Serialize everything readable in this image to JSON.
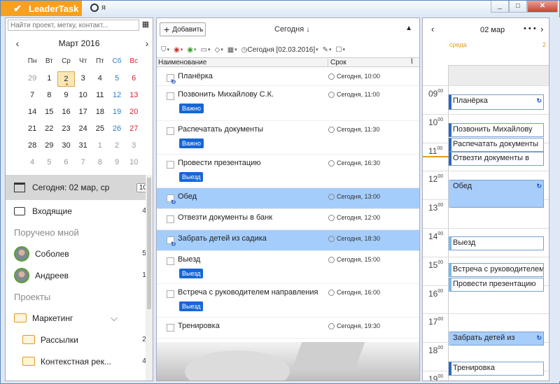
{
  "app": {
    "title": "LeaderTask",
    "user_label": "я"
  },
  "window_buttons": {
    "minimize": "_",
    "maximize": "□",
    "close": "✕"
  },
  "left": {
    "search_placeholder": "Найти проект, метку, контакт...",
    "calendar": {
      "title": "Март 2016",
      "prev": "‹",
      "next": "›",
      "dow": [
        "Пн",
        "Вт",
        "Ср",
        "Чт",
        "Пт",
        "Сб",
        "Вс"
      ],
      "weeks": [
        [
          "29",
          "1",
          "2",
          "3",
          "4",
          "5",
          "6"
        ],
        [
          "7",
          "8",
          "9",
          "10",
          "11",
          "12",
          "13"
        ],
        [
          "14",
          "15",
          "16",
          "17",
          "18",
          "19",
          "20"
        ],
        [
          "21",
          "22",
          "23",
          "24",
          "25",
          "26",
          "27"
        ],
        [
          "28",
          "29",
          "30",
          "31",
          "1",
          "2",
          "3"
        ],
        [
          "4",
          "5",
          "6",
          "7",
          "8",
          "9",
          "10"
        ]
      ],
      "selected": "2"
    },
    "today": {
      "label": "Сегодня: 02 мар, ср",
      "count": "10"
    },
    "inbox": {
      "label": "Входящие",
      "count": "4"
    },
    "assigned_section": "Поручено мной",
    "people": [
      {
        "name": "Соболев",
        "count": "5"
      },
      {
        "name": "Андреев",
        "count": "1"
      }
    ],
    "projects_section": "Проекты",
    "projects": [
      {
        "name": "Маркетинг",
        "count": ""
      },
      {
        "name": "Рассылки",
        "count": "2"
      },
      {
        "name": "Контекстная рек...",
        "count": "4"
      }
    ]
  },
  "middle": {
    "add_button": "Добавить",
    "title": "Сегодня ↓",
    "toolbar_date": "Сегодня [02.03.2016]",
    "col_name": "Наименование",
    "col_due": "Срок",
    "tasks": [
      {
        "name": "Планёрка",
        "time": "Сегодня, 10:00",
        "tag": "",
        "recur": true,
        "selected": false
      },
      {
        "name": "Позвонить Михайлову С.К.",
        "time": "Сегодня, 11:00",
        "tag": "Важно",
        "recur": false,
        "selected": false
      },
      {
        "name": "Распечатать документы",
        "time": "Сегодня, 11:30",
        "tag": "Важно",
        "recur": false,
        "selected": false
      },
      {
        "name": "Провести презентацию",
        "time": "Сегодня, 16:30",
        "tag": "Выезд",
        "recur": false,
        "selected": false
      },
      {
        "name": "Обед",
        "time": "Сегодня, 13:00",
        "tag": "",
        "recur": true,
        "selected": true
      },
      {
        "name": "Отвезти документы в банк",
        "time": "Сегодня, 12:00",
        "tag": "",
        "recur": false,
        "selected": false
      },
      {
        "name": "Забрать детей из садика",
        "time": "Сегодня, 18:30",
        "tag": "",
        "recur": true,
        "selected": true
      },
      {
        "name": "Выезд",
        "time": "Сегодня, 15:00",
        "tag": "Выезд",
        "recur": false,
        "selected": false
      },
      {
        "name": "Встреча с руководителем направления",
        "time": "Сегодня, 16:00",
        "tag": "Выезд",
        "recur": false,
        "selected": false
      },
      {
        "name": "Тренировка",
        "time": "Сегодня, 19:30",
        "tag": "",
        "recur": false,
        "selected": false
      }
    ]
  },
  "right": {
    "date": "02 мар",
    "dots": "• • •",
    "day_name": "среда",
    "day_num": "2",
    "hours": [
      "09",
      "10",
      "11",
      "12",
      "13",
      "14",
      "15",
      "16",
      "17",
      "18",
      "19"
    ],
    "hours_sup": "00",
    "events": [
      {
        "name": "Планёрка",
        "style": "white",
        "recur": true
      },
      {
        "name": "Позвонить Михайлову",
        "style": "white",
        "recur": false
      },
      {
        "name": "Распечатать документы",
        "style": "white",
        "recur": false
      },
      {
        "name": "Отвезти документы в",
        "style": "white",
        "recur": false
      },
      {
        "name": "Обед",
        "style": "blue",
        "recur": true
      },
      {
        "name": "Выезд",
        "style": "lt",
        "recur": false
      },
      {
        "name": "Встреча с руководителем",
        "style": "lt",
        "recur": false
      },
      {
        "name": "Провести презентацию",
        "style": "lt",
        "recur": false
      },
      {
        "name": "Забрать детей из",
        "style": "blue",
        "recur": true
      },
      {
        "name": "Тренировка",
        "style": "white",
        "recur": false
      }
    ]
  }
}
